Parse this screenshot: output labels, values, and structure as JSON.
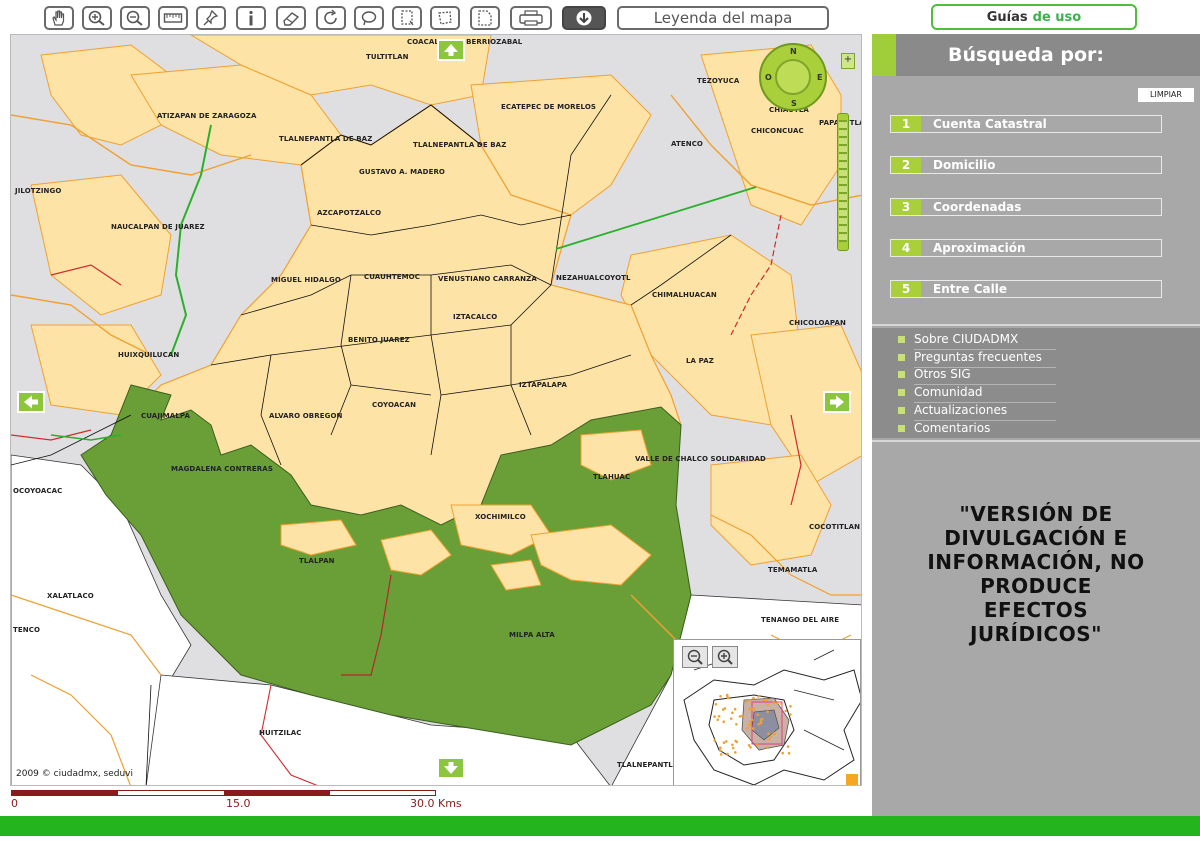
{
  "toolbar": {
    "tools": [
      {
        "name": "pan-tool",
        "icon": "hand-icon"
      },
      {
        "name": "zoom-in-tool",
        "icon": "zoom-in-icon"
      },
      {
        "name": "zoom-out-tool",
        "icon": "zoom-out-icon"
      },
      {
        "name": "measure-tool",
        "icon": "ruler-icon"
      },
      {
        "name": "pin-tool",
        "icon": "pushpin-icon"
      },
      {
        "name": "info-tool",
        "icon": "info-icon"
      },
      {
        "name": "erase-tool",
        "icon": "eraser-icon"
      },
      {
        "name": "refresh-tool",
        "icon": "refresh-icon"
      },
      {
        "name": "lasso-tool",
        "icon": "lasso-icon"
      },
      {
        "name": "select-rect-tool",
        "icon": "select-rect-icon"
      },
      {
        "name": "select-poly-tool",
        "icon": "select-poly-icon"
      },
      {
        "name": "select-area-tool",
        "icon": "select-area-icon"
      },
      {
        "name": "print-tool",
        "icon": "printer-icon"
      },
      {
        "name": "download-tool",
        "icon": "download-icon"
      }
    ],
    "legend_label": "Leyenda del mapa",
    "guides_label_a": "Guías",
    "guides_label_b": "de uso"
  },
  "map": {
    "labels": [
      "COACALCO DE BERRIOZABAL",
      "TULTITLAN",
      "TEZOYUCA",
      "CHIAUTLA",
      "PAPALOTLA",
      "CHICONCUAC",
      "ATIZAPAN DE ZARAGOZA",
      "TLALNEPANTLA DE BAZ",
      "ECATEPEC DE MORELOS",
      "TLALNEPANTLA DE BAZ",
      "ATENCO",
      "GUSTAVO A. MADERO",
      "JILOTZINGO",
      "AZCAPOTZALCO",
      "NAUCALPAN DE JUAREZ",
      "NEZAHUALCOYOTL",
      "MIGUEL HIDALGO",
      "CUAUHTEMOC",
      "VENUSTIANO CARRANZA",
      "CHIMALHUACAN",
      "IZTACALCO",
      "CHICOLOAPAN",
      "BENITO JUAREZ",
      "LA PAZ",
      "HUIXQUILUCAN",
      "IZTAPALAPA",
      "CUAJIMALPA",
      "COYOACAN",
      "ALVARO OBREGON",
      "VALLE DE CHALCO SOLIDARIDAD",
      "MAGDALENA CONTRERAS",
      "TLAHUAC",
      "OCOYOACAC",
      "XOCHIMILCO",
      "COCOTITLAN",
      "TLALPAN",
      "TEMAMATLA",
      "XALATLACO",
      "TENANGO DEL AIRE",
      "TENCO",
      "MILPA ALTA",
      "HUITZILAC",
      "TLALNEPANTLA"
    ],
    "compass": {
      "n": "N",
      "s": "S",
      "e": "E",
      "o": "O",
      "zoom_plus": "+"
    },
    "copyright": "2009 © ciudadmx, seduvi",
    "scale": {
      "labels": [
        "0",
        "15.0",
        "30.0 Kms"
      ],
      "max_km": 30
    }
  },
  "panel": {
    "title": "Búsqueda por:",
    "clear_label": "LIMPIAR",
    "search_options": [
      {
        "num": "1",
        "label": "Cuenta Catastral"
      },
      {
        "num": "2",
        "label": "Domicilio"
      },
      {
        "num": "3",
        "label": "Coordenadas"
      },
      {
        "num": "4",
        "label": "Aproximación"
      },
      {
        "num": "5",
        "label": "Entre Calle"
      }
    ],
    "links": [
      "Sobre CIUDADMX",
      "Preguntas frecuentes",
      "Otros SIG",
      "Comunidad",
      "Actualizaciones",
      "Comentarios"
    ],
    "disclaimer_lines": [
      "\"VERSIÓN DE",
      "DIVULGACIÓN E",
      "INFORMACIÓN, NO",
      "PRODUCE",
      "EFECTOS",
      "JURÍDICOS\""
    ]
  },
  "colors": {
    "urban_fill": "#fde3a6",
    "conservation_fill": "#6a9f38",
    "background_fill": "#dfdfe1",
    "accent_green": "#a9cf3a",
    "road_orange": "#f0a030",
    "road_red": "#d22b2b"
  }
}
